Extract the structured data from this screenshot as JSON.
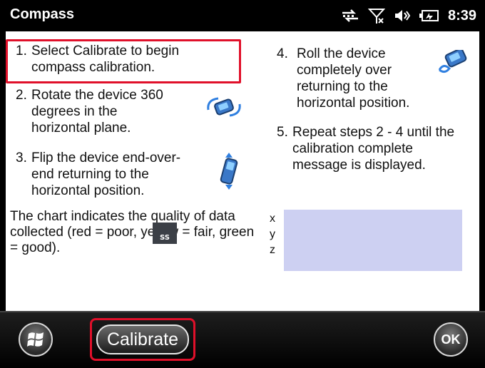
{
  "app": {
    "title": "Compass",
    "time": "8:39"
  },
  "steps": [
    {
      "num": "1.",
      "text": "Select Calibrate to begin compass calibration."
    },
    {
      "num": "2.",
      "text": "Rotate the device 360 degrees in the horizontal plane."
    },
    {
      "num": "3.",
      "text": "Flip the device end-over-end returning to the horizontal position."
    },
    {
      "num": "4.",
      "text": "Roll the device completely over returning to the horizontal position."
    },
    {
      "num": "5.",
      "text": "Repeat steps 2 - 4 until the calibration complete message is displayed."
    }
  ],
  "note": "The chart indicates the quality of data collected (red = poor, yellow = fair, green = good).",
  "axes": [
    "x",
    "y",
    "z"
  ],
  "overlay": "SS",
  "buttons": {
    "calibrate": "Calibrate",
    "ok": "OK"
  },
  "colors": {
    "highlight": "#e0102a",
    "chart_bg": "#cdd0f2",
    "icon_blue": "#2f7fe0"
  },
  "icons": [
    "sync-icon",
    "no-signal-icon",
    "volume-icon",
    "battery-icon",
    "windows-start-icon"
  ]
}
